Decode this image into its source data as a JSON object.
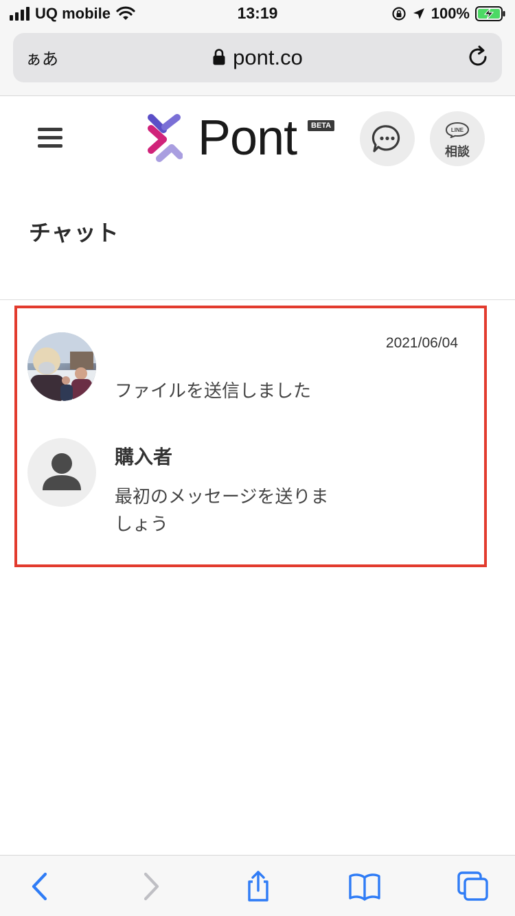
{
  "status_bar": {
    "carrier": "UQ mobile",
    "time": "13:19",
    "battery_percent": "100%",
    "icons": [
      "signal-icon",
      "wifi-icon",
      "orientation-lock-icon",
      "location-icon",
      "battery-charging-icon"
    ]
  },
  "browser": {
    "text_size_label": "ぁあ",
    "url": "pont.co",
    "icons": [
      "lock-icon",
      "reload-icon"
    ]
  },
  "header": {
    "logo_text": "Pont",
    "beta_badge": "BETA",
    "line_badge": "LINE",
    "line_button_label": "相談",
    "icons": [
      "hamburger-menu-icon",
      "chat-bubble-icon",
      "line-icon"
    ]
  },
  "page": {
    "title": "チャット"
  },
  "chat_list": [
    {
      "name": "",
      "date": "2021/06/04",
      "message": "ファイルを送信しました",
      "avatar": "photo"
    },
    {
      "name": "購入者",
      "date": "",
      "message": "最初のメッセージを送りましょう",
      "avatar": "default-user-icon"
    }
  ],
  "toolbar": {
    "icons": [
      "back-icon",
      "forward-icon",
      "share-icon",
      "bookmarks-icon",
      "tabs-icon"
    ]
  },
  "colors": {
    "highlight_border": "#e23b2e",
    "safari_blue": "#2f7cf6",
    "logo_magenta": "#d0237a",
    "logo_purple": "#5b4fc7",
    "logo_lavender": "#a99ee0"
  }
}
